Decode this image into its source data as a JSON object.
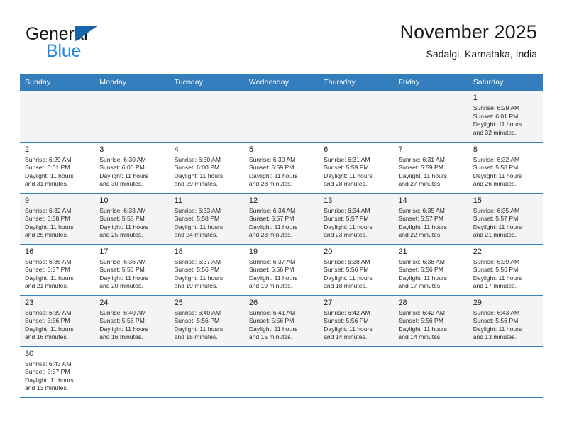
{
  "brand": {
    "name_top": "General",
    "name_bottom": "Blue",
    "flag_color": "#1565a8",
    "blue_color": "#2288dd"
  },
  "header": {
    "title": "November 2025",
    "subtitle": "Sadalgi, Karnataka, India"
  },
  "theme": {
    "header_bg": "#347ebd",
    "header_text": "#ffffff",
    "row_alt_bg": "#f4f4f4",
    "border": "#347ebd"
  },
  "weekdays": [
    "Sunday",
    "Monday",
    "Tuesday",
    "Wednesday",
    "Thursday",
    "Friday",
    "Saturday"
  ],
  "weeks": [
    [
      {
        "day": ""
      },
      {
        "day": ""
      },
      {
        "day": ""
      },
      {
        "day": ""
      },
      {
        "day": ""
      },
      {
        "day": ""
      },
      {
        "day": "1",
        "sunrise": "Sunrise: 6:29 AM",
        "sunset": "Sunset: 6:01 PM",
        "daylight1": "Daylight: 11 hours",
        "daylight2": "and 32 minutes."
      }
    ],
    [
      {
        "day": "2",
        "sunrise": "Sunrise: 6:29 AM",
        "sunset": "Sunset: 6:01 PM",
        "daylight1": "Daylight: 11 hours",
        "daylight2": "and 31 minutes."
      },
      {
        "day": "3",
        "sunrise": "Sunrise: 6:30 AM",
        "sunset": "Sunset: 6:00 PM",
        "daylight1": "Daylight: 11 hours",
        "daylight2": "and 30 minutes."
      },
      {
        "day": "4",
        "sunrise": "Sunrise: 6:30 AM",
        "sunset": "Sunset: 6:00 PM",
        "daylight1": "Daylight: 11 hours",
        "daylight2": "and 29 minutes."
      },
      {
        "day": "5",
        "sunrise": "Sunrise: 6:30 AM",
        "sunset": "Sunset: 5:59 PM",
        "daylight1": "Daylight: 11 hours",
        "daylight2": "and 28 minutes."
      },
      {
        "day": "6",
        "sunrise": "Sunrise: 6:31 AM",
        "sunset": "Sunset: 5:59 PM",
        "daylight1": "Daylight: 11 hours",
        "daylight2": "and 28 minutes."
      },
      {
        "day": "7",
        "sunrise": "Sunrise: 6:31 AM",
        "sunset": "Sunset: 5:59 PM",
        "daylight1": "Daylight: 11 hours",
        "daylight2": "and 27 minutes."
      },
      {
        "day": "8",
        "sunrise": "Sunrise: 6:32 AM",
        "sunset": "Sunset: 5:58 PM",
        "daylight1": "Daylight: 11 hours",
        "daylight2": "and 26 minutes."
      }
    ],
    [
      {
        "day": "9",
        "sunrise": "Sunrise: 6:32 AM",
        "sunset": "Sunset: 5:58 PM",
        "daylight1": "Daylight: 11 hours",
        "daylight2": "and 25 minutes."
      },
      {
        "day": "10",
        "sunrise": "Sunrise: 6:33 AM",
        "sunset": "Sunset: 5:58 PM",
        "daylight1": "Daylight: 11 hours",
        "daylight2": "and 25 minutes."
      },
      {
        "day": "11",
        "sunrise": "Sunrise: 6:33 AM",
        "sunset": "Sunset: 5:58 PM",
        "daylight1": "Daylight: 11 hours",
        "daylight2": "and 24 minutes."
      },
      {
        "day": "12",
        "sunrise": "Sunrise: 6:34 AM",
        "sunset": "Sunset: 5:57 PM",
        "daylight1": "Daylight: 11 hours",
        "daylight2": "and 23 minutes."
      },
      {
        "day": "13",
        "sunrise": "Sunrise: 6:34 AM",
        "sunset": "Sunset: 5:57 PM",
        "daylight1": "Daylight: 11 hours",
        "daylight2": "and 23 minutes."
      },
      {
        "day": "14",
        "sunrise": "Sunrise: 6:35 AM",
        "sunset": "Sunset: 5:57 PM",
        "daylight1": "Daylight: 11 hours",
        "daylight2": "and 22 minutes."
      },
      {
        "day": "15",
        "sunrise": "Sunrise: 6:35 AM",
        "sunset": "Sunset: 5:57 PM",
        "daylight1": "Daylight: 11 hours",
        "daylight2": "and 21 minutes."
      }
    ],
    [
      {
        "day": "16",
        "sunrise": "Sunrise: 6:36 AM",
        "sunset": "Sunset: 5:57 PM",
        "daylight1": "Daylight: 11 hours",
        "daylight2": "and 21 minutes."
      },
      {
        "day": "17",
        "sunrise": "Sunrise: 6:36 AM",
        "sunset": "Sunset: 5:56 PM",
        "daylight1": "Daylight: 11 hours",
        "daylight2": "and 20 minutes."
      },
      {
        "day": "18",
        "sunrise": "Sunrise: 6:37 AM",
        "sunset": "Sunset: 5:56 PM",
        "daylight1": "Daylight: 11 hours",
        "daylight2": "and 19 minutes."
      },
      {
        "day": "19",
        "sunrise": "Sunrise: 6:37 AM",
        "sunset": "Sunset: 5:56 PM",
        "daylight1": "Daylight: 11 hours",
        "daylight2": "and 19 minutes."
      },
      {
        "day": "20",
        "sunrise": "Sunrise: 6:38 AM",
        "sunset": "Sunset: 5:56 PM",
        "daylight1": "Daylight: 11 hours",
        "daylight2": "and 18 minutes."
      },
      {
        "day": "21",
        "sunrise": "Sunrise: 6:38 AM",
        "sunset": "Sunset: 5:56 PM",
        "daylight1": "Daylight: 11 hours",
        "daylight2": "and 17 minutes."
      },
      {
        "day": "22",
        "sunrise": "Sunrise: 6:39 AM",
        "sunset": "Sunset: 5:56 PM",
        "daylight1": "Daylight: 11 hours",
        "daylight2": "and 17 minutes."
      }
    ],
    [
      {
        "day": "23",
        "sunrise": "Sunrise: 6:39 AM",
        "sunset": "Sunset: 5:56 PM",
        "daylight1": "Daylight: 11 hours",
        "daylight2": "and 16 minutes."
      },
      {
        "day": "24",
        "sunrise": "Sunrise: 6:40 AM",
        "sunset": "Sunset: 5:56 PM",
        "daylight1": "Daylight: 11 hours",
        "daylight2": "and 16 minutes."
      },
      {
        "day": "25",
        "sunrise": "Sunrise: 6:40 AM",
        "sunset": "Sunset: 5:56 PM",
        "daylight1": "Daylight: 11 hours",
        "daylight2": "and 15 minutes."
      },
      {
        "day": "26",
        "sunrise": "Sunrise: 6:41 AM",
        "sunset": "Sunset: 5:56 PM",
        "daylight1": "Daylight: 11 hours",
        "daylight2": "and 15 minutes."
      },
      {
        "day": "27",
        "sunrise": "Sunrise: 6:42 AM",
        "sunset": "Sunset: 5:56 PM",
        "daylight1": "Daylight: 11 hours",
        "daylight2": "and 14 minutes."
      },
      {
        "day": "28",
        "sunrise": "Sunrise: 6:42 AM",
        "sunset": "Sunset: 5:56 PM",
        "daylight1": "Daylight: 11 hours",
        "daylight2": "and 14 minutes."
      },
      {
        "day": "29",
        "sunrise": "Sunrise: 6:43 AM",
        "sunset": "Sunset: 5:56 PM",
        "daylight1": "Daylight: 11 hours",
        "daylight2": "and 13 minutes."
      }
    ],
    [
      {
        "day": "30",
        "sunrise": "Sunrise: 6:43 AM",
        "sunset": "Sunset: 5:57 PM",
        "daylight1": "Daylight: 11 hours",
        "daylight2": "and 13 minutes."
      },
      {
        "day": ""
      },
      {
        "day": ""
      },
      {
        "day": ""
      },
      {
        "day": ""
      },
      {
        "day": ""
      },
      {
        "day": ""
      }
    ]
  ]
}
